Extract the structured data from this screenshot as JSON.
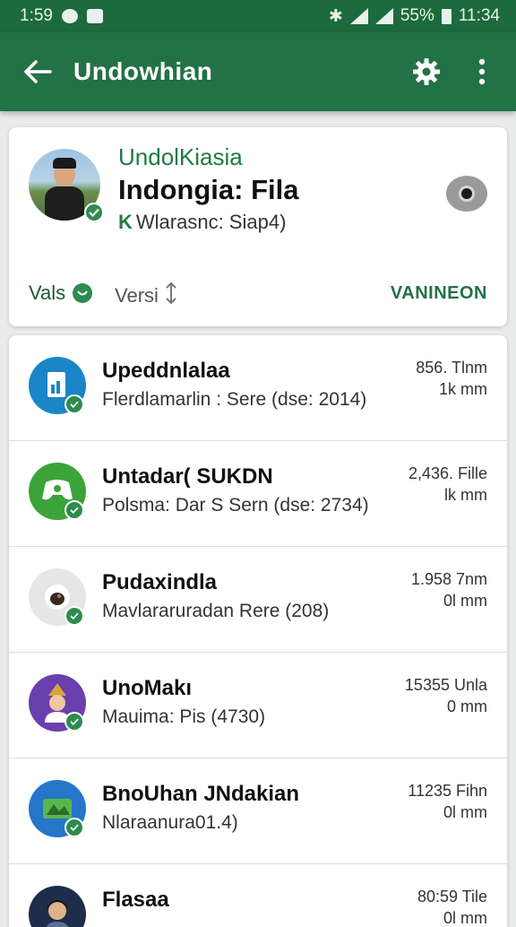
{
  "status_bar": {
    "time_left": "1:59",
    "battery": "55%",
    "time_right": "11:34"
  },
  "app_bar": {
    "title": "Undowhian"
  },
  "header": {
    "subtitle": "UndolKiasia",
    "title": "Indongia: Fila",
    "meta_mark": "K",
    "meta": "Wlarasnc: Siap4)",
    "vals_label": "Vals",
    "versi_label": "Versi",
    "action_label": "VANINEON"
  },
  "items": [
    {
      "name": "Upeddnlalaa",
      "desc": "Flerdlamarlin : Sere (dse: 2014)",
      "size": "856. Tlnm",
      "unit": "1k mm",
      "icon_color": "#1a86c7",
      "icon": "document-icon"
    },
    {
      "name": "Untadar( SUKDN",
      "desc": "Polsma: Dar S Sern (dse: 2734)",
      "size": "2,436. Fille",
      "unit": "lk mm",
      "icon_color": "#3ba33a",
      "icon": "game-controller-icon"
    },
    {
      "name": "Pudaxindla",
      "desc": "Mavlararuradan Rere (208)",
      "size": "1.958 7nm",
      "unit": "0l mm",
      "icon_color": "#e6e6e6",
      "icon": "drop-icon"
    },
    {
      "name": "UnoMakı",
      "desc": "Mauima: Pis (4730)",
      "size": "15355 Unla",
      "unit": "0 mm",
      "icon_color": "#6a3fae",
      "icon": "person-icon"
    },
    {
      "name": "BnoUhan JNdakian",
      "desc": "Nlaraanura01.4)",
      "size": "11235 Fihn",
      "unit": "0l mm",
      "icon_color": "#2576c8",
      "icon": "map-icon"
    },
    {
      "name": "Flasaa",
      "desc": "",
      "size": "80:59 Tile",
      "unit": "0l mm",
      "icon_color": "#1d2d4a",
      "icon": "portrait-icon"
    }
  ],
  "colors": {
    "brand": "#237146",
    "accent": "#2e8b4f"
  }
}
